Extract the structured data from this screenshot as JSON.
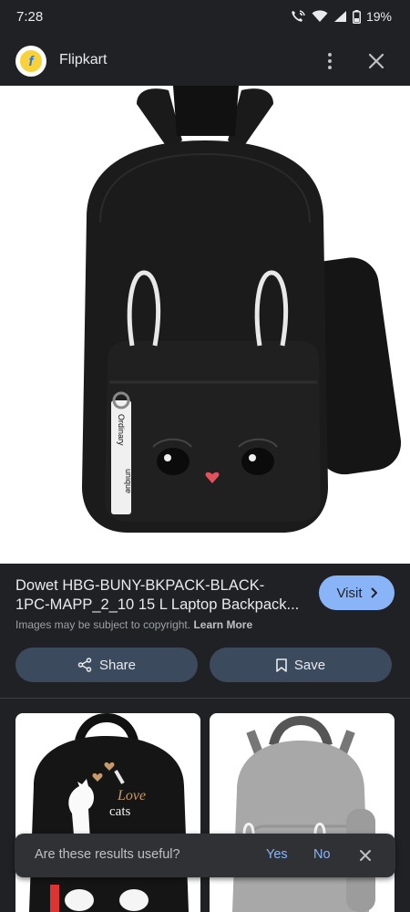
{
  "status": {
    "time": "7:28",
    "battery": "19%"
  },
  "header": {
    "site_name": "Flipkart",
    "logo_letter": "f"
  },
  "product": {
    "title_line1": "Dowet HBG-BUNY-BKPACK-BLACK-",
    "title_line2": "1PC-MAPP_2_10 15 L Laptop Backpack...",
    "tag_line1": "Ordinary",
    "tag_line2": "unique"
  },
  "visit": {
    "label": "Visit"
  },
  "copyright": {
    "text": "Images may be subject to copyright.",
    "link": "Learn More"
  },
  "actions": {
    "share_label": "Share",
    "save_label": "Save"
  },
  "related": {
    "thumb1_text_line1": "Love",
    "thumb1_text_line2": "cats"
  },
  "feedback": {
    "question": "Are these results useful?",
    "yes": "Yes",
    "no": "No"
  },
  "colors": {
    "background": "#202124",
    "accent": "#8ab4f8",
    "button": "#3c4a5e"
  }
}
